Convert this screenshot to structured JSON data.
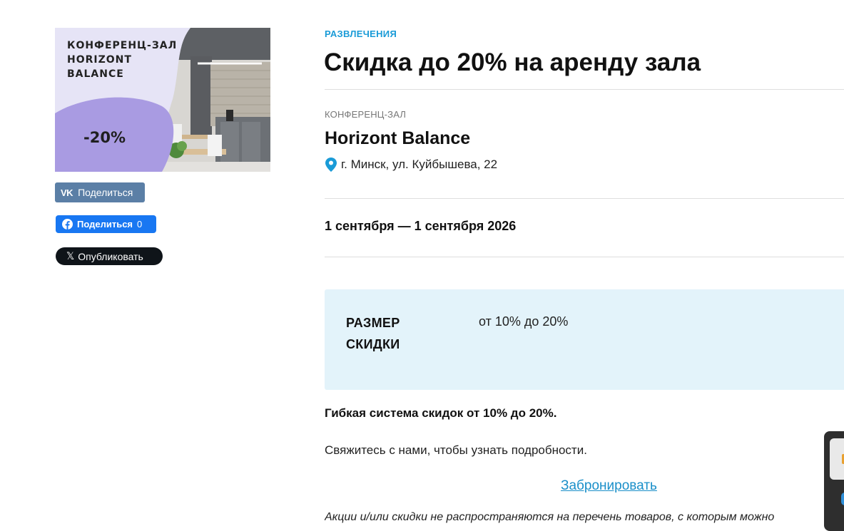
{
  "banner": {
    "title": "КОНФЕРЕНЦ-ЗАЛ\nHORIZONT\nBALANCE",
    "badge": "-20%"
  },
  "share": {
    "vk_label": "Поделиться",
    "fb_label": "Поделиться",
    "fb_count": "0",
    "x_label": "Опубликовать"
  },
  "article": {
    "category": "РАЗВЛЕЧЕНИЯ",
    "title": "Скидка до 20% на аренду зала"
  },
  "venue": {
    "type": "КОНФЕРЕНЦ-ЗАЛ",
    "name": "Horizont Balance",
    "address": "г. Минск, ул. Куйбышева, 22"
  },
  "dates": "1 сентября — 1 сентября 2026",
  "discount": {
    "label": "РАЗМЕР СКИДКИ",
    "value": "от 10% до 20%"
  },
  "body": {
    "bold_text": "Гибкая система скидок от 10% до 20%.",
    "text": "Свяжитесь с нами, чтобы узнать подробности.",
    "book_link": "Забронировать",
    "disclaimer": "Акции и/или скидки не распространяются на перечень товаров, с которым можно"
  },
  "colors": {
    "accent": "#1a9bd7",
    "vk": "#5b7fa6",
    "facebook": "#1877f2",
    "x": "#0f1419",
    "discount_bg": "#e3f3fa",
    "banner_purple": "#a99be2"
  },
  "icons": {
    "address": "map-pin-icon",
    "vk": "vk-icon",
    "fb": "facebook-icon",
    "x": "x-icon"
  }
}
